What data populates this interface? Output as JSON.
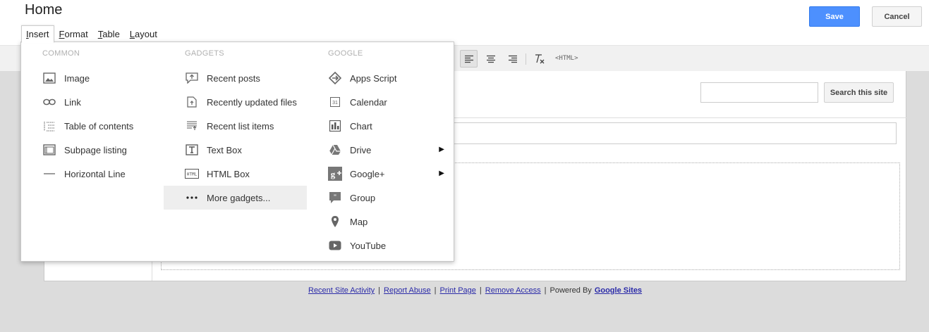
{
  "page": {
    "title": "Home"
  },
  "menubar": {
    "items": [
      {
        "label": "Insert",
        "key": "I",
        "rest": "nsert"
      },
      {
        "label": "Format",
        "key": "F",
        "rest": "ormat"
      },
      {
        "label": "Table",
        "key": "T",
        "rest": "able"
      },
      {
        "label": "Layout",
        "key": "L",
        "rest": "ayout"
      }
    ]
  },
  "actions": {
    "save": "Save",
    "cancel": "Cancel"
  },
  "toolbar": {
    "html_label": "<HTML>"
  },
  "search": {
    "button": "Search this site",
    "value": ""
  },
  "insert_menu": {
    "common": {
      "heading": "COMMON",
      "items": [
        "Image",
        "Link",
        "Table of contents",
        "Subpage listing",
        "Horizontal Line"
      ]
    },
    "gadgets": {
      "heading": "GADGETS",
      "items": [
        "Recent posts",
        "Recently updated files",
        "Recent list items",
        "Text Box",
        "HTML Box",
        "More gadgets..."
      ]
    },
    "google": {
      "heading": "GOOGLE",
      "items": [
        "Apps Script",
        "Calendar",
        "Chart",
        "Drive",
        "Google+",
        "Group",
        "Map",
        "YouTube"
      ]
    },
    "highlighted": "More gadgets..."
  },
  "footer": {
    "links": [
      "Recent Site Activity",
      "Report Abuse",
      "Print Page",
      "Remove Access"
    ],
    "powered_by": "Powered By",
    "brand": "Google Sites"
  }
}
